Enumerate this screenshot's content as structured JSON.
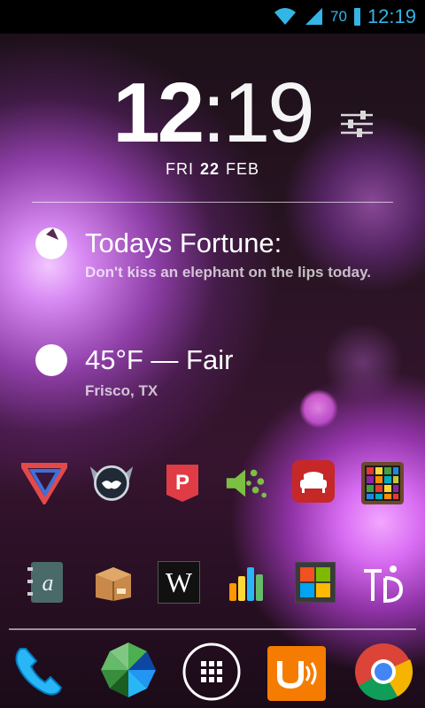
{
  "status": {
    "wifi_icon": "wifi-icon",
    "signal_icon": "signal-icon",
    "battery": "70",
    "time": "12:19"
  },
  "clock": {
    "hours": "12",
    "sep": ":",
    "minutes": "19"
  },
  "date": {
    "day": "FRI",
    "num": "22",
    "month": "FEB"
  },
  "fortune": {
    "title": "Todays Fortune:",
    "text": "Don't kiss an elephant on the lips today."
  },
  "weather": {
    "title": "45°F — Fair",
    "location": "Frisco, TX"
  },
  "apps_row1": [
    {
      "name": "vertical-v-app-icon"
    },
    {
      "name": "angry-bird-wings-icon"
    },
    {
      "name": "pocket-app-icon",
      "glyph": "P"
    },
    {
      "name": "sound-speaker-app-icon"
    },
    {
      "name": "sofa-app-icon"
    },
    {
      "name": "color-grid-app-icon"
    }
  ],
  "apps_row2": [
    {
      "name": "contacts-book-icon",
      "glyph": "a"
    },
    {
      "name": "package-box-icon"
    },
    {
      "name": "wikipedia-icon",
      "glyph": "W"
    },
    {
      "name": "bar-chart-app-icon"
    },
    {
      "name": "windows-tiles-icon"
    },
    {
      "name": "td-app-icon",
      "glyph": "TD"
    }
  ],
  "dock": [
    {
      "name": "phone-icon"
    },
    {
      "name": "photos-pinwheel-icon"
    },
    {
      "name": "app-drawer-icon"
    },
    {
      "name": "uber-media-icon",
      "glyph": "u"
    },
    {
      "name": "chrome-icon"
    }
  ],
  "colors": {
    "status_accent": "#33b5e5",
    "pocket": "#e03c45",
    "sofa": "#c62828",
    "orange_app": "#f57c00"
  }
}
